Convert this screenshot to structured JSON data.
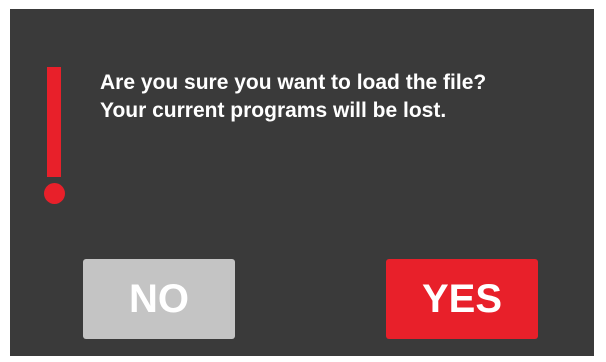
{
  "dialog": {
    "icon": "exclamation-icon",
    "message_line_1": "Are you sure you want to load the file?",
    "message_line_2": "Your current programs will be lost.",
    "no_label": "NO",
    "yes_label": "YES"
  },
  "colors": {
    "background": "#3a3a3a",
    "accent": "#e8202a",
    "disabled_button": "#c4c4c4",
    "text": "#ffffff"
  }
}
